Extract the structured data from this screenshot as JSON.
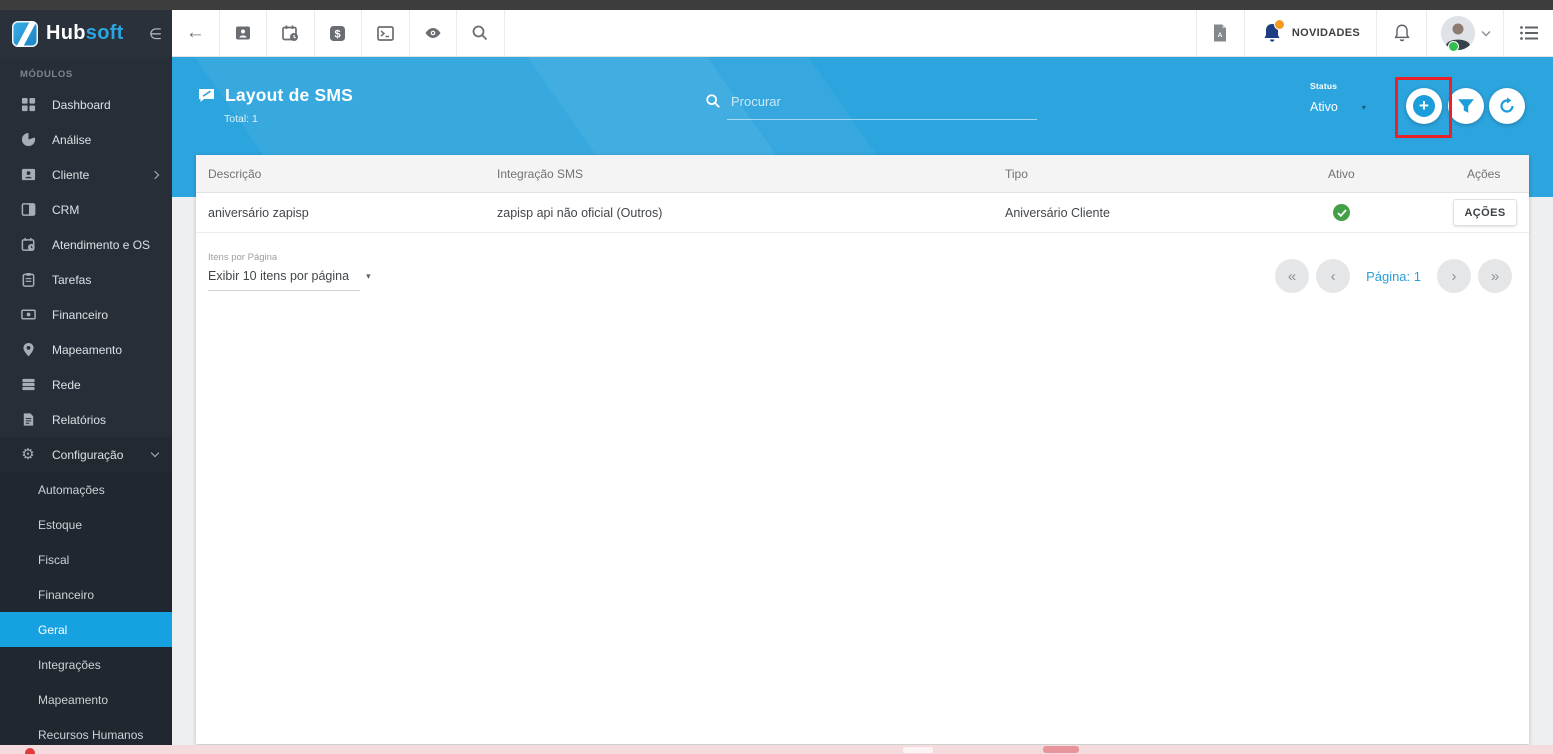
{
  "brand": {
    "prefix": "Hub",
    "suffix": "soft",
    "collapse_glyph": "∈"
  },
  "topbar": {
    "left_icons": [
      "back-arrow",
      "contact-card",
      "calendar-schedule",
      "money",
      "terminal",
      "eye-preview",
      "search"
    ],
    "right": {
      "pdf_icon": "pdf-file",
      "news_label": "NOVIDADES",
      "bell_icon": "notifications-bell",
      "avatar_status": "online",
      "menu_icon": "list-menu"
    }
  },
  "sidebar": {
    "section_label": "MÓDULOS",
    "items": [
      {
        "label": "Dashboard",
        "icon": "dashboard-grid"
      },
      {
        "label": "Análise",
        "icon": "pie-chart"
      },
      {
        "label": "Cliente",
        "icon": "contact-card",
        "chevron": "right"
      },
      {
        "label": "CRM",
        "icon": "kanban-board"
      },
      {
        "label": "Atendimento e OS",
        "icon": "calendar-clock"
      },
      {
        "label": "Tarefas",
        "icon": "clipboard"
      },
      {
        "label": "Financeiro",
        "icon": "banknote"
      },
      {
        "label": "Mapeamento",
        "icon": "map-pin"
      },
      {
        "label": "Rede",
        "icon": "server-stack"
      },
      {
        "label": "Relatórios",
        "icon": "report-document"
      },
      {
        "label": "Configuração",
        "icon": "gear",
        "chevron": "down",
        "expanded": true
      }
    ],
    "submenu": [
      {
        "label": "Automações",
        "active": false
      },
      {
        "label": "Estoque",
        "active": false
      },
      {
        "label": "Fiscal",
        "active": false
      },
      {
        "label": "Financeiro",
        "active": false
      },
      {
        "label": "Geral",
        "active": true
      },
      {
        "label": "Integrações",
        "active": false
      },
      {
        "label": "Mapeamento",
        "active": false
      },
      {
        "label": "Recursos Humanos",
        "active": false
      }
    ],
    "active_color": "#16a1e0"
  },
  "page_header": {
    "title": "Layout de SMS",
    "total_label": "Total: 1",
    "search_placeholder": "Procurar",
    "status_label": "Status",
    "status_value": "Ativo",
    "accent_color": "#2ca4de",
    "buttons": [
      "add",
      "filter",
      "refresh"
    ]
  },
  "table": {
    "columns": [
      "Descrição",
      "Integração SMS",
      "Tipo",
      "Ativo",
      "Ações"
    ],
    "rows": [
      {
        "descricao": "aniversário zapisp",
        "integracao": "zapisp api não oficial (Outros)",
        "tipo": "Aniversário Cliente",
        "ativo": true,
        "acoes_label": "AÇÕES"
      }
    ],
    "active_check_color": "#43a047"
  },
  "pagination": {
    "items_per_page_label": "Itens por Página",
    "items_per_page_value": "Exibir 10 itens por página",
    "caret": "▾",
    "page_label": "Página: 1",
    "first": "«",
    "prev": "‹",
    "next": "›",
    "last": "»"
  },
  "annotation": {
    "highlight_color": "#ea2127",
    "highlighted_element": "add-button"
  }
}
